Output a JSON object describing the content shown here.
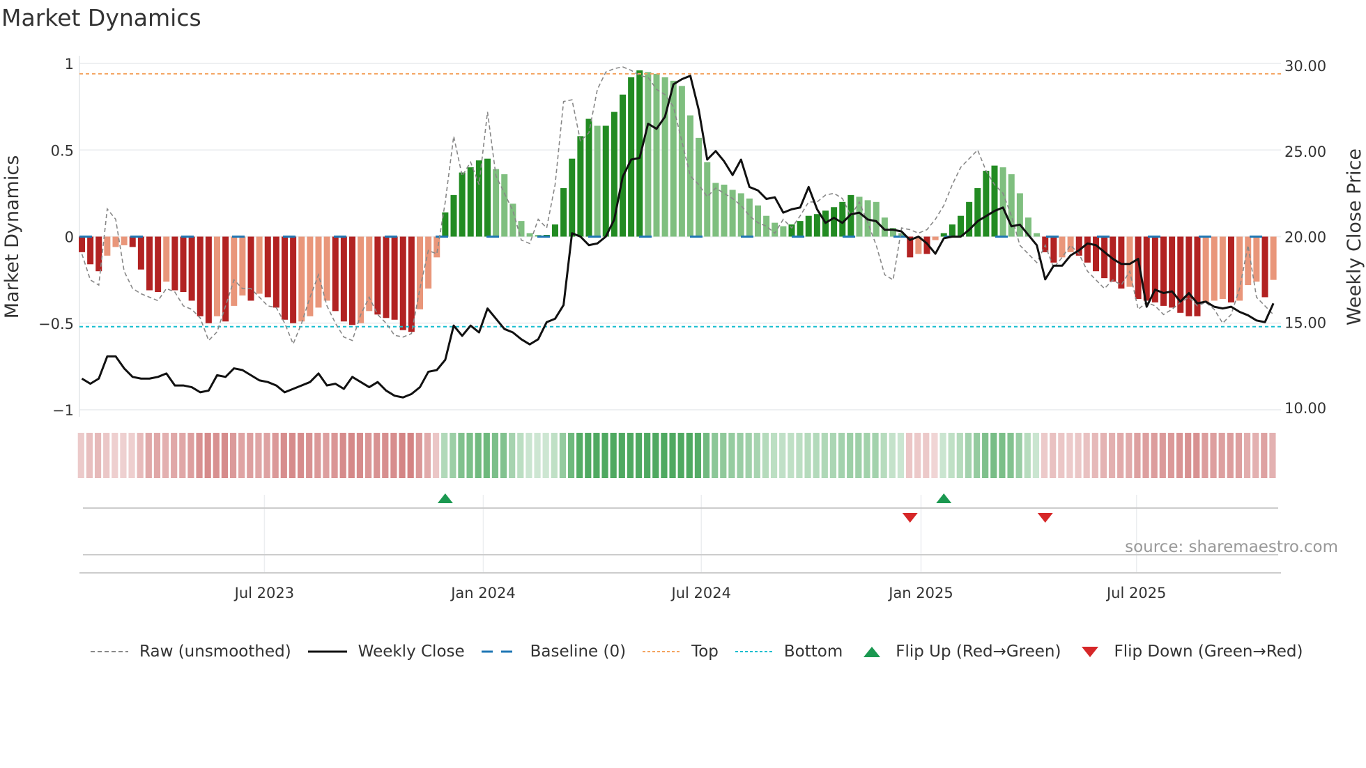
{
  "title": "Market Dynamics",
  "source": "source: sharemaestro.com",
  "legend": [
    {
      "label": "Raw (unsmoothed)",
      "icon": "dashed-gray-line"
    },
    {
      "label": "Weekly Close",
      "icon": "solid-black-line"
    },
    {
      "label": "Baseline (0)",
      "icon": "dashed-blue-line"
    },
    {
      "label": "Top",
      "icon": "dotted-orange-line"
    },
    {
      "label": "Bottom",
      "icon": "dotted-cyan-line"
    },
    {
      "label": "Flip Up (Red→Green)",
      "icon": "green-up-triangle"
    },
    {
      "label": "Flip Down (Green→Red)",
      "icon": "red-down-triangle"
    }
  ],
  "colors": {
    "green_dark": "#228b22",
    "green_light": "#7fbf7f",
    "red_dark": "#b22222",
    "red_light": "#e9967a",
    "top": "#f4a460",
    "bottom": "#17becf",
    "baseline": "#1f77b4",
    "flip_up": "#1a9850",
    "flip_down": "#d62728"
  },
  "chart_data": {
    "type": "bar",
    "title": "Market Dynamics",
    "ylabel": "Market Dynamics",
    "y2label": "Weekly Close Price",
    "ylim": [
      -1,
      1
    ],
    "y2lim": [
      10,
      30
    ],
    "yticks": [
      "1",
      "0.5",
      "0",
      "−0.5",
      "−1"
    ],
    "yticks_values": [
      1,
      0.5,
      0,
      -0.5,
      -1
    ],
    "y2ticks": [
      "30.00",
      "25.00",
      "20.00",
      "15.00",
      "10.00"
    ],
    "y2ticks_values": [
      30,
      25,
      20,
      15,
      10
    ],
    "xticks": [
      {
        "label": "Jul 2023",
        "week": 21.6
      },
      {
        "label": "Jan 2024",
        "week": 47.5
      },
      {
        "label": "Jul 2024",
        "week": 73.3
      },
      {
        "label": "Jan 2025",
        "week": 99.3
      },
      {
        "label": "Jul 2025",
        "week": 124.8
      }
    ],
    "top": 0.94,
    "bottom": -0.52,
    "baseline": 0,
    "smoothed": [
      -0.09,
      -0.16,
      -0.2,
      -0.11,
      -0.06,
      -0.05,
      -0.06,
      -0.19,
      -0.31,
      -0.32,
      -0.26,
      -0.31,
      -0.32,
      -0.37,
      -0.46,
      -0.5,
      -0.46,
      -0.49,
      -0.4,
      -0.34,
      -0.37,
      -0.33,
      -0.35,
      -0.41,
      -0.48,
      -0.5,
      -0.49,
      -0.46,
      -0.41,
      -0.37,
      -0.43,
      -0.49,
      -0.51,
      -0.5,
      -0.43,
      -0.45,
      -0.47,
      -0.48,
      -0.54,
      -0.55,
      -0.42,
      -0.3,
      -0.12,
      0.14,
      0.24,
      0.37,
      0.4,
      0.44,
      0.45,
      0.39,
      0.36,
      0.19,
      0.09,
      0.02,
      0.01,
      0.01,
      0.07,
      0.28,
      0.45,
      0.58,
      0.68,
      0.64,
      0.64,
      0.72,
      0.82,
      0.92,
      0.96,
      0.95,
      0.94,
      0.92,
      0.9,
      0.87,
      0.7,
      0.57,
      0.43,
      0.31,
      0.3,
      0.27,
      0.25,
      0.22,
      0.18,
      0.12,
      0.08,
      0.06,
      0.07,
      0.09,
      0.12,
      0.13,
      0.15,
      0.17,
      0.2,
      0.24,
      0.23,
      0.21,
      0.2,
      0.11,
      0.05,
      0.02,
      -0.12,
      -0.1,
      -0.1,
      -0.02,
      0.02,
      0.07,
      0.12,
      0.2,
      0.28,
      0.38,
      0.41,
      0.4,
      0.36,
      0.25,
      0.11,
      0.02,
      -0.09,
      -0.15,
      -0.12,
      -0.09,
      -0.11,
      -0.15,
      -0.2,
      -0.24,
      -0.26,
      -0.3,
      -0.29,
      -0.36,
      -0.37,
      -0.38,
      -0.4,
      -0.41,
      -0.44,
      -0.46,
      -0.46,
      -0.38,
      -0.37,
      -0.36,
      -0.38,
      -0.37,
      -0.28,
      -0.26,
      -0.35,
      -0.25
    ],
    "raw": [
      -0.1,
      -0.25,
      -0.28,
      0.16,
      0.1,
      -0.2,
      -0.3,
      -0.33,
      -0.35,
      -0.37,
      -0.3,
      -0.32,
      -0.4,
      -0.42,
      -0.47,
      -0.6,
      -0.55,
      -0.4,
      -0.25,
      -0.3,
      -0.3,
      -0.35,
      -0.4,
      -0.41,
      -0.5,
      -0.62,
      -0.5,
      -0.35,
      -0.22,
      -0.4,
      -0.5,
      -0.58,
      -0.6,
      -0.45,
      -0.35,
      -0.45,
      -0.5,
      -0.57,
      -0.58,
      -0.56,
      -0.3,
      -0.08,
      -0.1,
      0.2,
      0.58,
      0.35,
      0.43,
      0.3,
      0.72,
      0.35,
      0.25,
      0.15,
      -0.02,
      -0.04,
      0.1,
      0.05,
      0.3,
      0.78,
      0.79,
      0.55,
      0.6,
      0.85,
      0.95,
      0.97,
      0.98,
      0.96,
      0.93,
      0.92,
      0.85,
      0.82,
      0.75,
      0.55,
      0.35,
      0.3,
      0.23,
      0.28,
      0.25,
      0.22,
      0.18,
      0.12,
      0.08,
      0.06,
      0.02,
      0.1,
      0.05,
      0.12,
      0.2,
      0.2,
      0.24,
      0.25,
      0.22,
      0.12,
      0.2,
      0.08,
      -0.05,
      -0.22,
      -0.25,
      0.05,
      0.04,
      0.02,
      0.04,
      0.1,
      0.18,
      0.3,
      0.4,
      0.45,
      0.5,
      0.38,
      0.3,
      0.25,
      0.12,
      -0.05,
      -0.1,
      -0.15,
      -0.05,
      -0.18,
      -0.12,
      -0.05,
      -0.1,
      -0.2,
      -0.25,
      -0.3,
      -0.25,
      -0.28,
      -0.2,
      -0.42,
      -0.38,
      -0.4,
      -0.45,
      -0.42,
      -0.38,
      -0.35,
      -0.4,
      -0.38,
      -0.42,
      -0.5,
      -0.45,
      -0.3,
      -0.05,
      -0.35,
      -0.4,
      -0.45
    ],
    "close": [
      11.7,
      11.4,
      11.7,
      13.0,
      13.0,
      12.3,
      11.8,
      11.7,
      11.7,
      11.8,
      12.0,
      11.3,
      11.3,
      11.2,
      10.9,
      11.0,
      11.9,
      11.8,
      12.3,
      12.2,
      11.9,
      11.6,
      11.5,
      11.3,
      10.9,
      11.1,
      11.3,
      11.5,
      12.0,
      11.3,
      11.4,
      11.1,
      11.8,
      11.5,
      11.2,
      11.5,
      11.0,
      10.7,
      10.6,
      10.8,
      11.2,
      12.1,
      12.2,
      12.8,
      14.8,
      14.2,
      14.8,
      14.4,
      15.8,
      15.2,
      14.6,
      14.4,
      14.0,
      13.7,
      14.0,
      15.0,
      15.2,
      16.0,
      20.2,
      20.0,
      19.5,
      19.6,
      20.0,
      21.0,
      23.5,
      24.5,
      24.6,
      26.6,
      26.3,
      27.0,
      28.9,
      29.2,
      29.4,
      27.4,
      24.5,
      25.0,
      24.4,
      23.6,
      24.5,
      22.9,
      22.7,
      22.2,
      22.3,
      21.4,
      21.6,
      21.7,
      22.9,
      21.6,
      20.8,
      21.1,
      20.8,
      21.3,
      21.4,
      21.0,
      20.9,
      20.4,
      20.4,
      20.3,
      19.8,
      20.0,
      19.6,
      19.0,
      19.9,
      20.0,
      20.0,
      20.4,
      20.9,
      21.2,
      21.5,
      21.7,
      20.6,
      20.7,
      20.1,
      19.5,
      17.5,
      18.3,
      18.3,
      18.9,
      19.2,
      19.6,
      19.5,
      19.1,
      18.7,
      18.4,
      18.4,
      18.7,
      15.9,
      16.9,
      16.7,
      16.8,
      16.2,
      16.7,
      16.1,
      16.2,
      15.9,
      15.8,
      15.9,
      15.6,
      15.4,
      15.1,
      15.0,
      16.1,
      15.3,
      14.8
    ],
    "flips": [
      {
        "week": 43,
        "direction": "up"
      },
      {
        "week": 98,
        "direction": "down"
      },
      {
        "week": 102,
        "direction": "up"
      },
      {
        "week": 114,
        "direction": "down"
      }
    ]
  }
}
